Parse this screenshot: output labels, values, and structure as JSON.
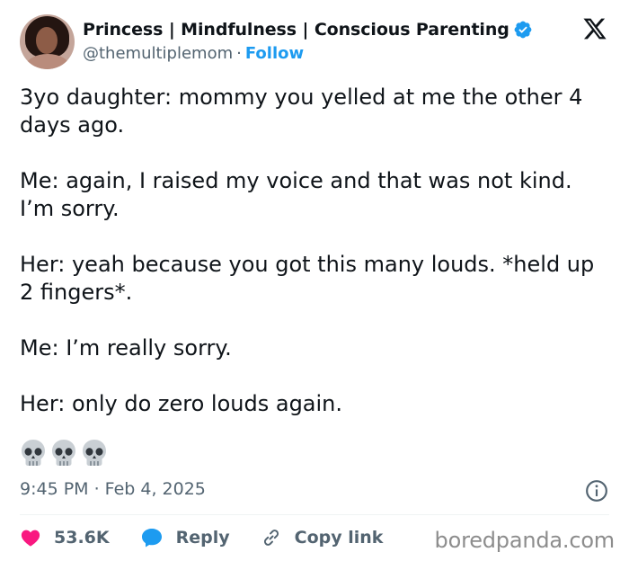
{
  "author": {
    "display_name": "Princess | Mindfulness | Conscious Parenting",
    "handle": "@themultiplemom",
    "separator": "·",
    "follow_label": "Follow",
    "verified_color": "#1d9bf0",
    "avatar_icon": "profile-photo"
  },
  "tweet": {
    "paragraphs": [
      "3yo daughter: mommy you yelled at me the other 4 days ago.",
      "Me: again, I raised my voice and that was not kind. I’m sorry.",
      "Her: yeah because you got this many louds. *held up 2 fingers*.",
      "Me: I’m really sorry.",
      "Her: only do zero louds again."
    ],
    "emojis": [
      "skull",
      "skull",
      "skull"
    ],
    "timestamp": "9:45 PM · Feb 4, 2025"
  },
  "actions": {
    "likes": "53.6K",
    "reply_label": "Reply",
    "copy_link_label": "Copy link",
    "like_color": "#f91880",
    "reply_color": "#1d9bf0"
  },
  "watermark": "boredpanda.com"
}
